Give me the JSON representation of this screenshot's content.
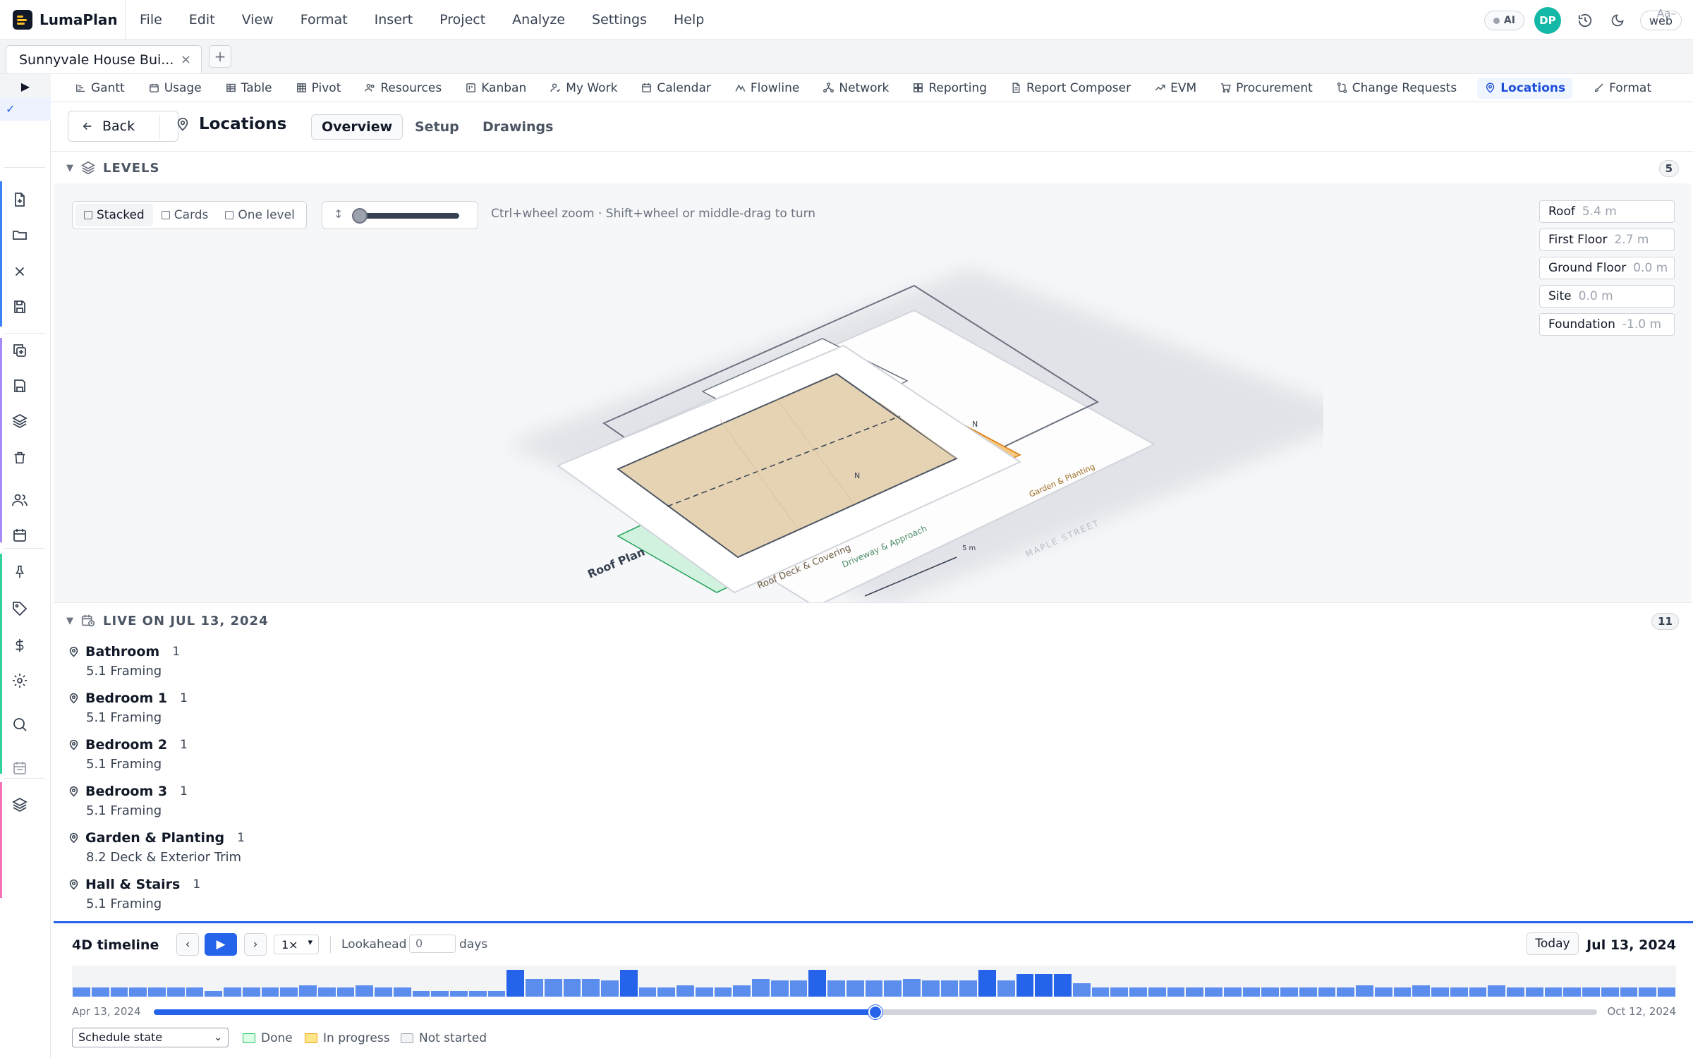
{
  "app": {
    "name": "LumaPlan"
  },
  "menu": [
    "File",
    "Edit",
    "View",
    "Format",
    "Insert",
    "Project",
    "Analyze",
    "Settings",
    "Help"
  ],
  "topbar": {
    "ai_label": "AI",
    "avatar_initials": "DP",
    "avatar_color": "#14b8a6",
    "platform_label": "web"
  },
  "doc_tab": {
    "title": "Sunnyvale House Bui...",
    "close": "×",
    "new_tab": "+"
  },
  "rail": {
    "toggle": "▶",
    "check": "✓"
  },
  "views": [
    {
      "label": "Gantt",
      "icon": "gantt-icon"
    },
    {
      "label": "Usage",
      "icon": "usage-icon"
    },
    {
      "label": "Table",
      "icon": "table-icon"
    },
    {
      "label": "Pivot",
      "icon": "pivot-icon"
    },
    {
      "label": "Resources",
      "icon": "resources-icon"
    },
    {
      "label": "Kanban",
      "icon": "kanban-icon"
    },
    {
      "label": "My Work",
      "icon": "my-work-icon"
    },
    {
      "label": "Calendar",
      "icon": "calendar-icon"
    },
    {
      "label": "Flowline",
      "icon": "flowline-icon"
    },
    {
      "label": "Network",
      "icon": "network-icon"
    },
    {
      "label": "Reporting",
      "icon": "reporting-icon"
    },
    {
      "label": "Report Composer",
      "icon": "report-composer-icon"
    },
    {
      "label": "EVM",
      "icon": "evm-icon"
    },
    {
      "label": "Procurement",
      "icon": "cart-icon"
    },
    {
      "label": "Change Requests",
      "icon": "change-requests-icon"
    },
    {
      "label": "Locations",
      "icon": "location-pin-icon",
      "active": true
    },
    {
      "label": "Format",
      "icon": "brush-icon"
    }
  ],
  "font_toggle": "Aa–",
  "page": {
    "back_label": "Back",
    "title": "Locations",
    "subtabs": [
      "Overview",
      "Setup",
      "Drawings"
    ],
    "active_subtab": "Overview"
  },
  "levels": {
    "section_title": "LEVELS",
    "count": "5",
    "modes": [
      "Stacked",
      "Cards",
      "One level"
    ],
    "active_mode": "Stacked",
    "spread_fraction": 0.0,
    "hint": "Ctrl+wheel zoom · Shift+wheel or middle-drag to turn",
    "list": [
      {
        "name": "Roof",
        "elevation": "5.4 m"
      },
      {
        "name": "First Floor",
        "elevation": "2.7 m"
      },
      {
        "name": "Ground Floor",
        "elevation": "0.0 m"
      },
      {
        "name": "Site",
        "elevation": "0.0 m"
      },
      {
        "name": "Foundation",
        "elevation": "-1.0 m"
      }
    ],
    "scene_labels": {
      "roof_plan": "Roof Plan",
      "roof_deck": "Roof Deck & Covering",
      "scale": "5 m",
      "driveway": "Driveway & Approach",
      "garden": "Garden & Planting",
      "street": "MAPLE STREET",
      "north": "N"
    },
    "scene_colors": {
      "roof_zone": "#e6d3b3",
      "garden_zone": "#f8c77e",
      "driveway_zone": "#d1f2df"
    }
  },
  "live": {
    "section_title": "LIVE ON JUL 13, 2024",
    "count": "11",
    "items": [
      {
        "name": "Bathroom",
        "count": "1",
        "task": "5.1 Framing"
      },
      {
        "name": "Bedroom 1",
        "count": "1",
        "task": "5.1 Framing"
      },
      {
        "name": "Bedroom 2",
        "count": "1",
        "task": "5.1 Framing"
      },
      {
        "name": "Bedroom 3",
        "count": "1",
        "task": "5.1 Framing"
      },
      {
        "name": "Garden & Planting",
        "count": "1",
        "task": "8.2 Deck & Exterior Trim"
      },
      {
        "name": "Hall & Stairs",
        "count": "1",
        "task": "5.1 Framing"
      }
    ]
  },
  "timeline": {
    "title": "4D timeline",
    "prev": "‹",
    "play": "▶",
    "next": "›",
    "speed": "1×",
    "lookahead_label": "Lookahead",
    "lookahead_value": "0",
    "days_label": "days",
    "today_label": "Today",
    "current_date": "Jul 13, 2024",
    "start_date": "Apr 13, 2024",
    "end_date": "Oct 12, 2024",
    "progress": 0.5,
    "histogram": [
      1,
      1,
      1,
      1,
      1,
      1,
      1,
      0.6,
      1,
      1,
      1,
      1,
      1.3,
      1,
      1,
      1.3,
      1,
      1,
      0.6,
      0.6,
      0.6,
      0.6,
      0.6,
      3,
      2,
      2,
      2,
      2,
      1.8,
      3,
      1,
      1,
      1.3,
      1,
      1,
      1.3,
      2,
      1.8,
      1.8,
      3,
      1.8,
      1.8,
      1.8,
      1.8,
      2,
      1.8,
      1.8,
      1.8,
      3,
      1.8,
      2.5,
      2.5,
      2.5,
      1.5,
      1,
      1,
      1,
      1,
      1,
      1,
      1,
      1,
      1,
      1,
      1,
      1,
      1,
      1,
      1.3,
      1,
      1,
      1.3,
      1,
      1,
      1,
      1.3,
      1,
      1,
      1,
      1,
      1,
      1,
      1,
      1,
      1
    ],
    "state_select": "Schedule state",
    "legend": [
      {
        "label": "Done",
        "color": "#22c55e",
        "fill": "#dcfce7"
      },
      {
        "label": "In progress",
        "color": "#f59e0b",
        "fill": "#fde68a"
      },
      {
        "label": "Not started",
        "color": "#9ca3af",
        "fill": "#f3f4f6"
      }
    ]
  }
}
